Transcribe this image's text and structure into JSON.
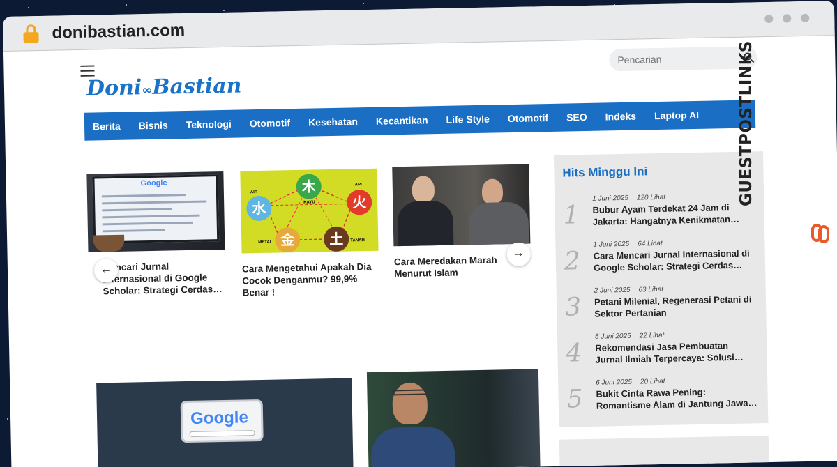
{
  "browser": {
    "url": "donibastian.com"
  },
  "header": {
    "search_placeholder": "Pencarian",
    "logo_text": "Doni",
    "logo_text2": "Bastian"
  },
  "nav": {
    "items": [
      "Berita",
      "Bisnis",
      "Teknologi",
      "Otomotif",
      "Kesehatan",
      "Kecantikan",
      "Life Style",
      "Otomotif",
      "SEO",
      "Indeks",
      "Laptop AI"
    ]
  },
  "slider": {
    "cards": [
      {
        "title": "Cara Mencari Jurnal Internasional di Google Scholar: Strategi Cerdas…",
        "visible_title": "Mencari Jurnal Internasional di Google Scholar: Strategi Cerdas…"
      },
      {
        "title": "Cara Mengetahui Apakah Dia Cocok Denganmu? 99,9% Benar !"
      },
      {
        "title": "Cara Meredakan Marah Menurut Islam"
      }
    ],
    "prev_icon": "arrow-left-icon",
    "next_icon": "arrow-right-icon"
  },
  "thumb_text": {
    "google": "Google",
    "elements": {
      "air": "AIR",
      "kayu": "KAYU",
      "api": "API",
      "metal": "METAL",
      "tanah": "TANAH"
    }
  },
  "sidebar": {
    "title": "Hits Minggu Ini",
    "hits": [
      {
        "rank": "1",
        "date": "1 Juni 2025",
        "views": "120 Lihat",
        "title": "Bubur Ayam Terdekat 24 Jam di Jakarta: Hangatnya Kenikmatan…"
      },
      {
        "rank": "2",
        "date": "1 Juni 2025",
        "views": "64 Lihat",
        "title": "Cara Mencari Jurnal Internasional di Google Scholar: Strategi Cerdas…"
      },
      {
        "rank": "3",
        "date": "2 Juni 2025",
        "views": "63 Lihat",
        "title": "Petani Milenial, Regenerasi Petani di Sektor Pertanian"
      },
      {
        "rank": "4",
        "date": "5 Juni 2025",
        "views": "22 Lihat",
        "title": "Rekomendasi Jasa Pembuatan Jurnal Ilmiah Terpercaya: Solusi…"
      },
      {
        "rank": "5",
        "date": "6 Juni 2025",
        "views": "20 Lihat",
        "title": "Bukit Cinta Rawa Pening: Romantisme Alam di Jantung Jawa…"
      }
    ]
  },
  "watermark": {
    "text": "GUESTPOSTLINKS"
  },
  "colors": {
    "brand": "#1a6fc4",
    "nav_bg": "#1a6fc4",
    "sidebar_bg": "#e8e8e8",
    "background": "#0d1a33"
  }
}
